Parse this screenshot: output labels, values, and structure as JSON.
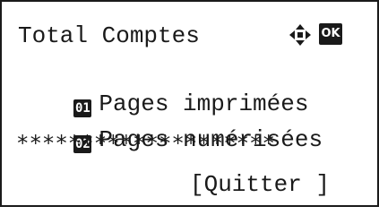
{
  "screen": {
    "title": "Total Comptes",
    "ok_label": "OK",
    "menu": [
      {
        "number": "01",
        "label": "Pages imprimées"
      },
      {
        "number": "02",
        "label": "Pages numérisées"
      }
    ],
    "stars": "********************",
    "exit_label": "[Quitter ]"
  }
}
